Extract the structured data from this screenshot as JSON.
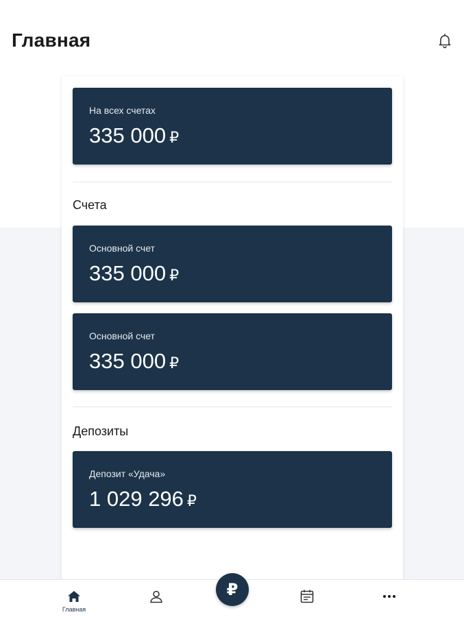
{
  "header": {
    "title": "Главная",
    "bell_icon": "bell-icon"
  },
  "summary": {
    "label": "На всех счетах",
    "amount": "335 000",
    "currency": "₽"
  },
  "accounts": {
    "section_title": "Счета",
    "items": [
      {
        "label": "Основной счет",
        "amount": "335 000",
        "currency": "₽"
      },
      {
        "label": "Основной счет",
        "amount": "335 000",
        "currency": "₽"
      }
    ]
  },
  "deposits": {
    "section_title": "Депозиты",
    "items": [
      {
        "label": "Депозит «Удача»",
        "amount": "1 029 296",
        "currency": "₽"
      }
    ]
  },
  "bottom_nav": {
    "items": [
      {
        "label": "Главная",
        "icon": "home-icon",
        "active": true
      },
      {
        "label": "",
        "icon": "profile-icon"
      },
      {
        "label": "",
        "icon": "ruble-icon",
        "glyph": "₽"
      },
      {
        "label": "",
        "icon": "calendar-icon"
      },
      {
        "label": "",
        "icon": "more-icon"
      }
    ]
  },
  "colors": {
    "card_bg": "#1c3349",
    "card_text": "#ffffff",
    "page_bg": "#ffffff",
    "lower_bg": "#f3f5f8"
  }
}
